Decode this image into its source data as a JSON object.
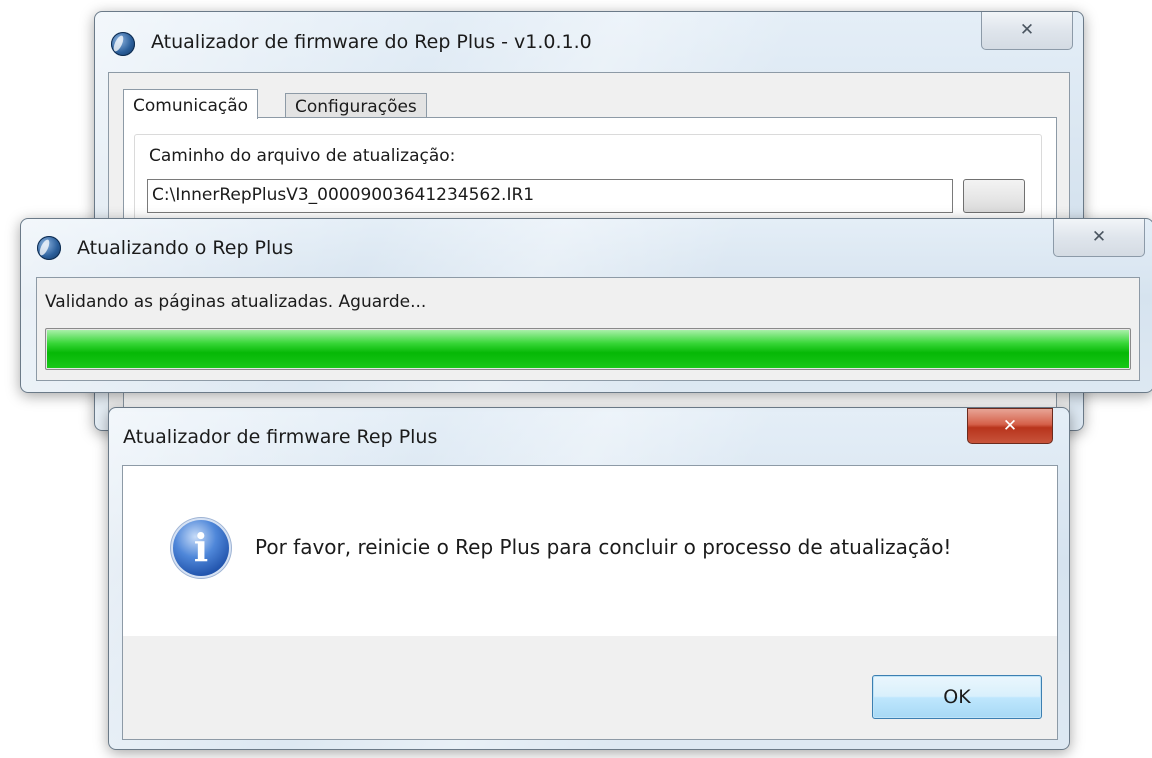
{
  "main_window": {
    "title": "Atualizador de firmware do Rep Plus  -  v1.0.1.0",
    "close_glyph": "✕",
    "tabs": [
      {
        "label": "Comunicação",
        "active": true
      },
      {
        "label": "Configurações",
        "active": false
      }
    ],
    "file_path_label": "Caminho do arquivo de atualização:",
    "file_path_value": "C:\\InnerRepPlusV3_00009003641234562.IR1"
  },
  "progress_window": {
    "title": "Atualizando o Rep Plus",
    "close_glyph": "✕",
    "status_text": "Validando as páginas atualizadas. Aguarde...",
    "progress_fraction": 1.0,
    "progress_color": "#06b806"
  },
  "message_box": {
    "title": "Atualizador de firmware Rep Plus",
    "close_glyph": "✕",
    "icon": "information-icon",
    "icon_glyph": "i",
    "message": "Por favor, reinicie o Rep Plus para concluir o processo de atualização!",
    "ok_label": "OK"
  }
}
